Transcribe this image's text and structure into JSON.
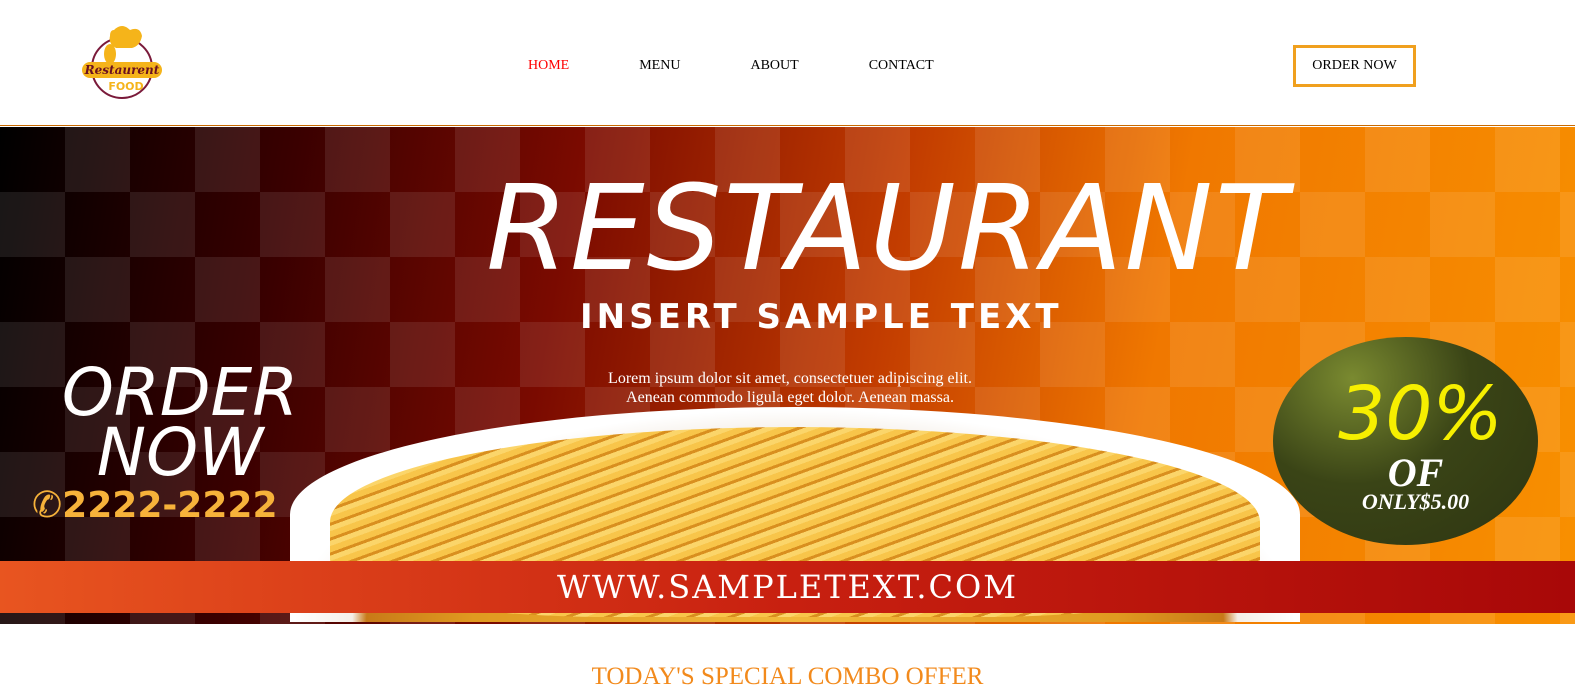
{
  "logo": {
    "text": "Restaurent",
    "subtext": "FOOD"
  },
  "nav": {
    "items": [
      {
        "label": "HOME",
        "active": true
      },
      {
        "label": "MENU"
      },
      {
        "label": "ABOUT"
      },
      {
        "label": "CONTACT"
      }
    ]
  },
  "header": {
    "order_button": "ORDER NOW"
  },
  "banner": {
    "title": "RESTAURANT",
    "subtitle": "INSERT SAMPLE TEXT",
    "lorem_line1": "Lorem ipsum dolor sit amet, consectetuer adipiscing elit.",
    "lorem_line2": "Aenean commodo ligula eget dolor. Aenean massa.",
    "order_line1": "ORDER",
    "order_line2": "NOW",
    "phone": "2222-2222",
    "discount": "30%",
    "discount_of": "OF",
    "discount_price": "ONLY$5.00",
    "website": "WWW.SAMPLETEXT.COM"
  },
  "section": {
    "title": "TODAY'S SPECIAL COMBO OFFER"
  }
}
